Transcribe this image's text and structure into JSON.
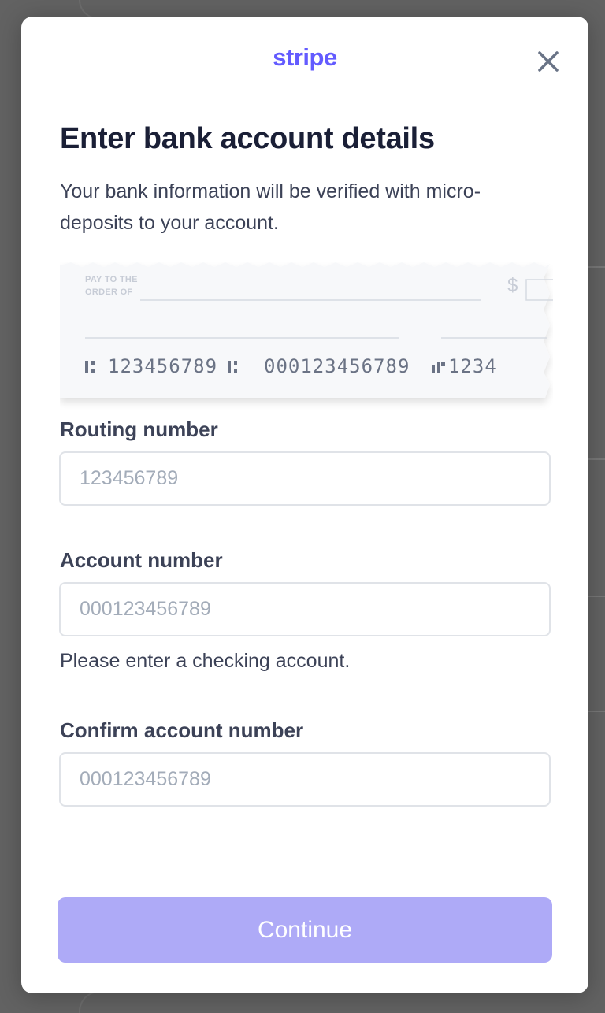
{
  "brand": {
    "name": "stripe",
    "color": "#635bff"
  },
  "close": {
    "icon": "close-icon"
  },
  "heading": {
    "title": "Enter bank account details",
    "subtitle": "Your bank information will be verified with micro-deposits to your account."
  },
  "cheque": {
    "pay_line_1": "PAY TO THE",
    "pay_line_2": "ORDER OF",
    "currency_symbol": "$",
    "routing_example": "123456789",
    "account_example": "000123456789",
    "check_number_example": "1234"
  },
  "routing": {
    "label": "Routing number",
    "placeholder": "123456789",
    "value": ""
  },
  "account": {
    "label": "Account number",
    "placeholder": "000123456789",
    "value": "",
    "hint": "Please enter a checking account."
  },
  "confirm": {
    "label": "Confirm account number",
    "placeholder": "000123456789",
    "value": ""
  },
  "footer": {
    "continue_label": "Continue",
    "continue_color": "#aeaaf7"
  }
}
